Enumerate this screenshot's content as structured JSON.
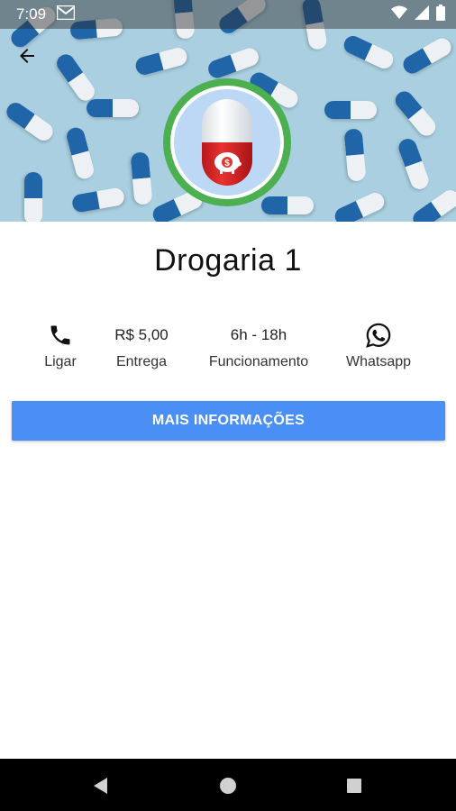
{
  "status_bar": {
    "time": "7:09"
  },
  "pharmacy": {
    "name": "Drogaria 1"
  },
  "actions": {
    "call": {
      "label": "Ligar"
    },
    "delivery": {
      "value": "R$  5,00",
      "label": "Entrega"
    },
    "hours": {
      "value": "6h - 18h",
      "label": "Funcionamento"
    },
    "whatsapp": {
      "label": "Whatsapp"
    }
  },
  "more_info_button": {
    "label": "MAIS INFORMAÇÕES"
  },
  "colors": {
    "accent": "#4a8ff5",
    "logo_ring": "#4caf50",
    "header_bg": "#a9cfe0",
    "pill_blue": "#1f65a8"
  },
  "icons": [
    "back-arrow-icon",
    "phone-icon",
    "whatsapp-icon",
    "gmail-icon",
    "wifi-icon",
    "signal-icon",
    "battery-icon",
    "nav-back-icon",
    "nav-home-icon",
    "nav-recents-icon"
  ]
}
